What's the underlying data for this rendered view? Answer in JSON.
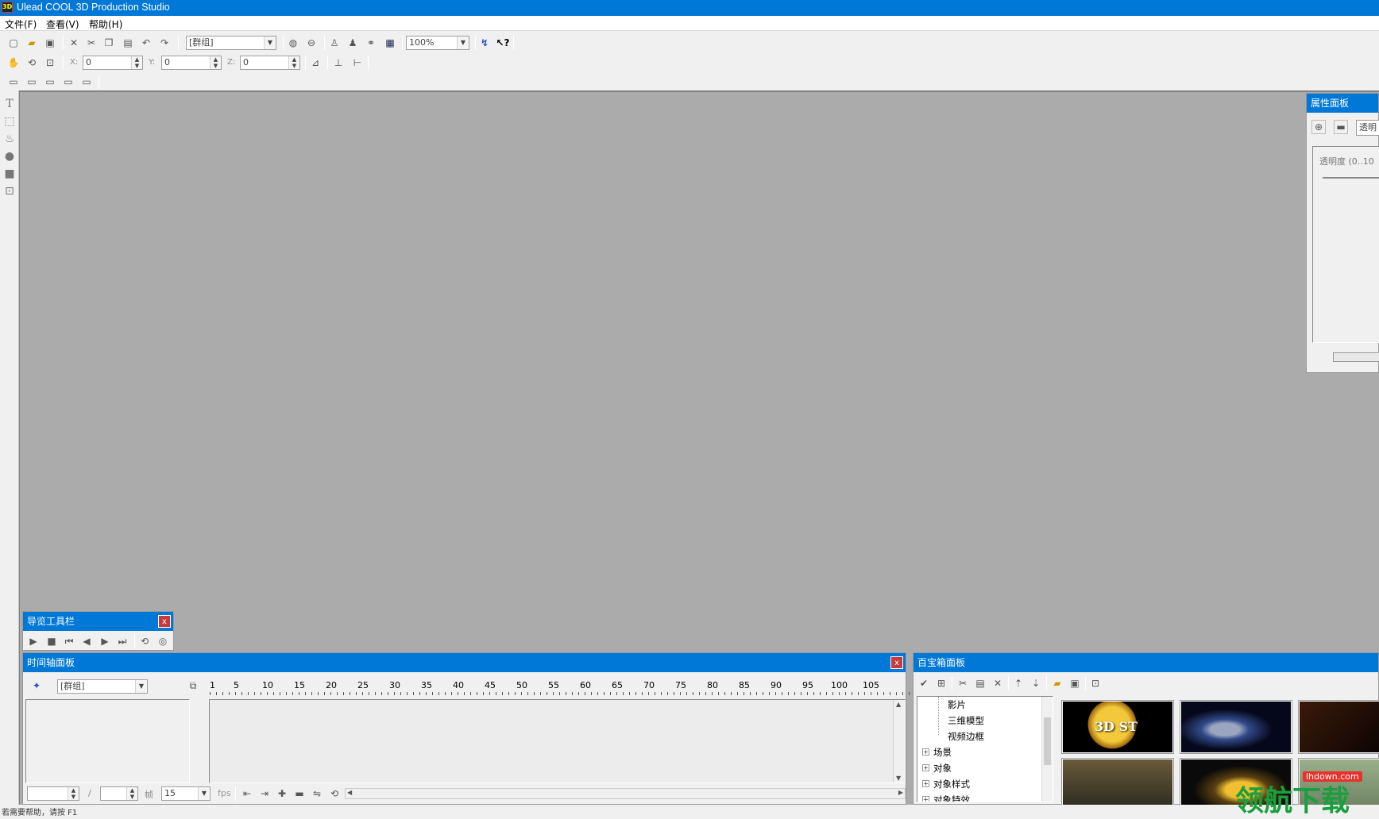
{
  "app": {
    "title": "Ulead COOL 3D Production Studio",
    "icon_text": "3D"
  },
  "menu": [
    "文件(F)",
    "查看(V)",
    "帮助(H)"
  ],
  "toolbar": {
    "group_select": "[群组]",
    "zoom": "100%",
    "x_label": "X:",
    "y_label": "Y:",
    "z_label": "Z:",
    "x_value": "0",
    "y_value": "0",
    "z_value": "0"
  },
  "properties_panel": {
    "title": "属性面板",
    "tab_label": "透明",
    "opacity_label": "透明度 (0..10"
  },
  "nav_toolbar": {
    "title": "导览工具栏",
    "close": "x"
  },
  "timeline": {
    "title": "时间轴面板",
    "close": "x",
    "object_select": "[群组]",
    "ruler": [
      "1",
      "5",
      "10",
      "15",
      "20",
      "25",
      "30",
      "35",
      "40",
      "45",
      "50",
      "55",
      "60",
      "65",
      "70",
      "75",
      "80",
      "85",
      "90",
      "95",
      "100",
      "105"
    ],
    "frame_label": "帧",
    "fps_value": "15",
    "fps_label": "fps",
    "slash": "/"
  },
  "library": {
    "title": "百宝箱面板",
    "tree": [
      {
        "label": "影片",
        "expandable": false
      },
      {
        "label": "三维模型",
        "expandable": false
      },
      {
        "label": "视频边框",
        "expandable": false
      },
      {
        "label": "场景",
        "expandable": true
      },
      {
        "label": "对象",
        "expandable": true
      },
      {
        "label": "对象样式",
        "expandable": true
      },
      {
        "label": "对象特效",
        "expandable": true
      }
    ],
    "thumb_text_1": "3D ST"
  },
  "status": {
    "text": "若需要帮助，请按 F1"
  },
  "watermark": {
    "text": "领航下载",
    "site": "lhdown.com"
  },
  "colors": {
    "titlebar": "#0078d7",
    "workspace": "#ababab",
    "close": "#c83b3b"
  }
}
